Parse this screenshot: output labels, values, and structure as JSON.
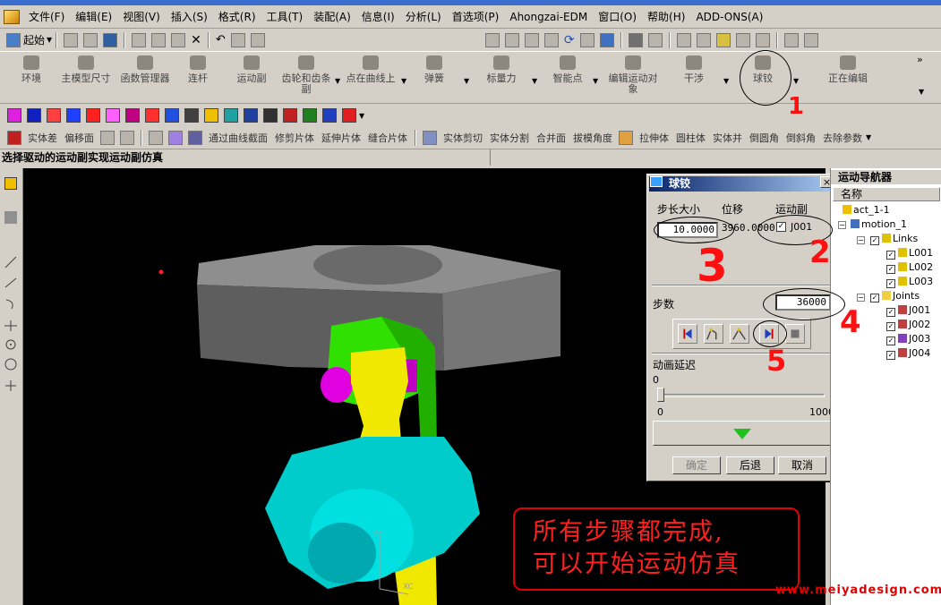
{
  "menu": [
    "文件(F)",
    "编辑(E)",
    "视图(V)",
    "插入(S)",
    "格式(R)",
    "工具(T)",
    "装配(A)",
    "信息(I)",
    "分析(L)",
    "首选项(P)",
    "Ahongzai-EDM",
    "窗口(O)",
    "帮助(H)",
    "ADD-ONS(A)"
  ],
  "toolbar": {
    "start_label": "起始",
    "motion_buttons": [
      {
        "label": "环境",
        "name": "environment-button"
      },
      {
        "label": "主模型尺寸",
        "name": "master-model-dimension-button"
      },
      {
        "label": "函数管理器",
        "name": "function-manager-button"
      },
      {
        "label": "连杆",
        "name": "link-button"
      },
      {
        "label": "运动副",
        "name": "joint-button"
      },
      {
        "label": "齿轮和齿条副",
        "name": "gear-rack-joint-button"
      },
      {
        "label": "点在曲线上",
        "name": "point-on-curve-button"
      },
      {
        "label": "弹簧",
        "name": "spring-button"
      },
      {
        "label": "标量力",
        "name": "scalar-force-button"
      },
      {
        "label": "智能点",
        "name": "smart-point-button"
      },
      {
        "label": "编辑运动对象",
        "name": "edit-motion-object-button"
      },
      {
        "label": "干涉",
        "name": "interference-button"
      },
      {
        "label": "球铰",
        "name": "spherical-joint-button"
      },
      {
        "label": "正在编辑",
        "name": "editing-button"
      }
    ],
    "feature_tools": [
      "实体差",
      "偏移面",
      "通过曲线截面",
      "修剪片体",
      "延伸片体",
      "缝合片体",
      "实体剪切",
      "实体分割",
      "合并面",
      "拔模角度",
      "拉伸体",
      "圆柱体",
      "实体并",
      "倒圆角",
      "倒斜角",
      "去除参数"
    ]
  },
  "cue_line": "选择驱动的运动副实现运动副仿真",
  "dialog": {
    "title": "球铰",
    "close_label": "×",
    "col_step_size": "步长大小",
    "col_displacement": "位移",
    "col_joint": "运动副",
    "step_size_value": "10.0000",
    "displacement_value": "3960.0000",
    "joint_label": "J001",
    "steps_label": "步数",
    "steps_value": "36000",
    "anim_delay_label": "动画延迟",
    "slider_value": "0",
    "slider_min": "0",
    "slider_max": "1000",
    "slider_fraction": 0.0,
    "ok_label": "确定",
    "back_label": "后退",
    "cancel_label": "取消"
  },
  "navigator": {
    "title": "运动导航器",
    "column": "名称",
    "root": "act_1-1",
    "motion": "motion_1",
    "links_group": "Links",
    "links": [
      "L001",
      "L002",
      "L003"
    ],
    "joints_group": "Joints",
    "joints": [
      "J001",
      "J002",
      "J003",
      "J004"
    ]
  },
  "annotation": {
    "steps": [
      "1",
      "2",
      "3",
      "4",
      "5"
    ],
    "line1": "所有步骤都完成,",
    "line2": "可以开始运动仿真"
  },
  "axis_label": "ZC",
  "axis_label2": "XC",
  "watermark": "www.meiyadesign.com",
  "colors": {
    "annotation": "#ff1010",
    "viewport": "#000000",
    "title_bar": "#0a246a",
    "cyan_part": "#00d4d4",
    "yellow_part": "#f0e800",
    "green_part": "#30e000",
    "magenta_part": "#e000e0",
    "gray_part": "#6e6e6e"
  }
}
